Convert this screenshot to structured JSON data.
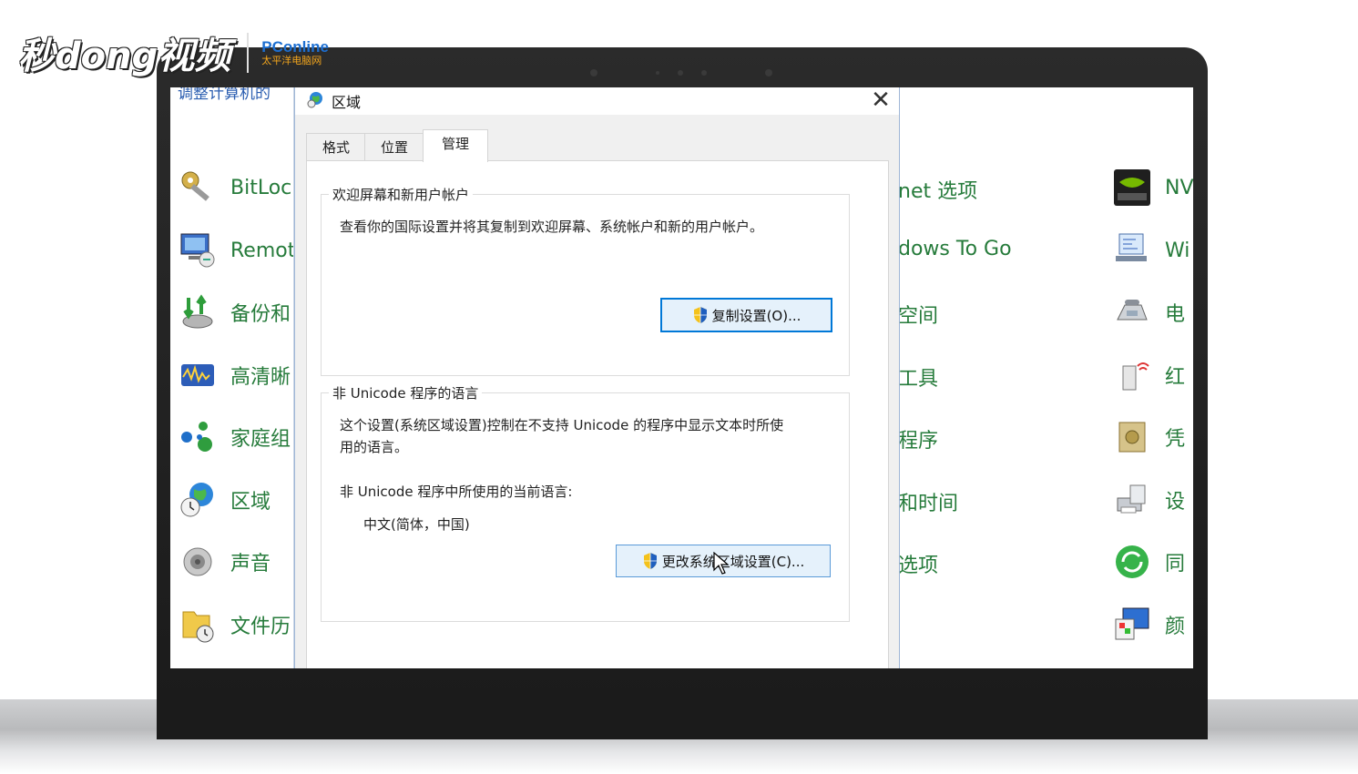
{
  "watermark": {
    "logo": "秒dong视频",
    "brand_top": "PConline",
    "brand_sub": "太平洋电脑网"
  },
  "control_panel": {
    "header": "调整计算机的",
    "col1": [
      {
        "label": "BitLocl",
        "icon": "bitlocker-key-icon"
      },
      {
        "label": "Remot",
        "icon": "remote-app-icon"
      },
      {
        "label": "备份和",
        "icon": "backup-restore-icon"
      },
      {
        "label": "高清晰",
        "icon": "realtek-audio-icon"
      },
      {
        "label": "家庭组",
        "icon": "homegroup-icon"
      },
      {
        "label": "区域",
        "icon": "region-globe-icon"
      },
      {
        "label": "声音",
        "icon": "speaker-icon"
      },
      {
        "label": "文件历",
        "icon": "file-history-icon"
      }
    ],
    "col2": [
      "net 选项",
      "dows To Go",
      "空间",
      "工具",
      "程序",
      "和时间",
      "选项"
    ],
    "col3": [
      {
        "label": "NV",
        "icon": "nvidia-icon"
      },
      {
        "label": "Wi",
        "icon": "windows-mobility-icon"
      },
      {
        "label": "电",
        "icon": "phone-modem-icon"
      },
      {
        "label": "红",
        "icon": "infrared-icon"
      },
      {
        "label": "凭",
        "icon": "credential-vault-icon"
      },
      {
        "label": "设",
        "icon": "device-printer-icon"
      },
      {
        "label": "同",
        "icon": "sync-center-icon"
      },
      {
        "label": "颜",
        "icon": "color-management-icon"
      }
    ]
  },
  "dialog": {
    "title": "区域",
    "close": "✕",
    "tabs": [
      "格式",
      "位置",
      "管理"
    ],
    "active_tab": "管理",
    "welcome_group": {
      "legend": "欢迎屏幕和新用户帐户",
      "description": "查看你的国际设置并将其复制到欢迎屏幕、系统帐户和新的用户帐户。",
      "button": "复制设置(O)..."
    },
    "unicode_group": {
      "legend": "非 Unicode 程序的语言",
      "description_line1": "这个设置(系统区域设置)控制在不支持 Unicode 的程序中显示文本时所使",
      "description_line2": "用的语言。",
      "current_label": "非 Unicode 程序中所使用的当前语言:",
      "current_value": "中文(简体，中国)",
      "button": "更改系统区域设置(C)..."
    }
  },
  "colors": {
    "accent": "#0078d7",
    "control_panel_link": "#267b3b",
    "dialog_bg": "#f0f0f0"
  }
}
